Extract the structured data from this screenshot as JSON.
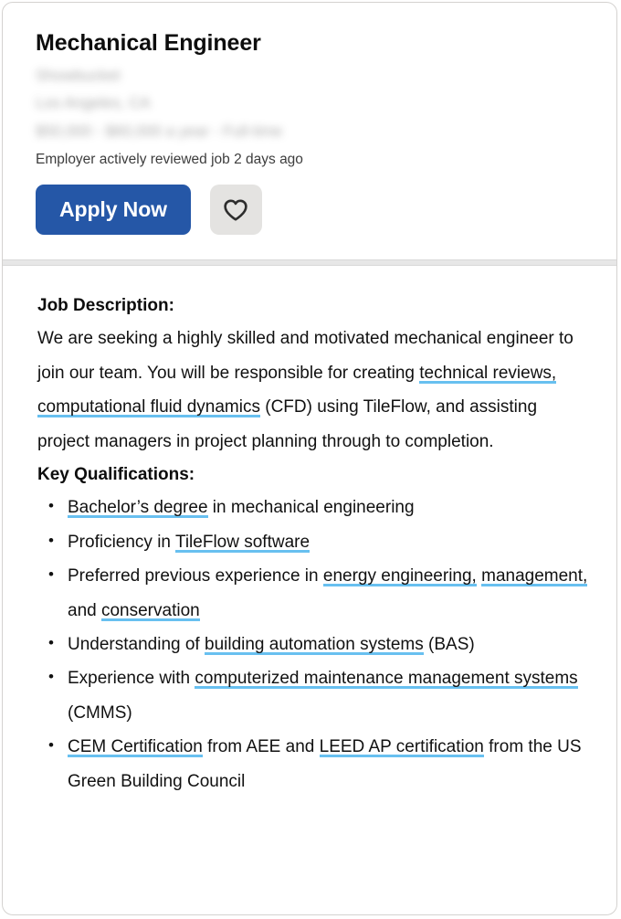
{
  "card": {
    "accent_blue": "#2557a7",
    "highlight_blue": "#68c0f0",
    "save_button_bg": "#e4e3e1"
  },
  "header": {
    "title": "Mechanical Engineer",
    "company": "Showbucket",
    "location": "Los Angeles, CA",
    "salary": "$50,000 - $60,000 a year  -  Full-time",
    "reviewed_note": "Employer actively reviewed job 2 days ago",
    "apply_label": "Apply Now",
    "save_icon": "heart-icon"
  },
  "body": {
    "description_heading": "Job Description:",
    "description": {
      "part1": "We are seeking a highly skilled and motivated mechanical engineer to join our team. You will be responsible for creating ",
      "hl1": "technical reviews,",
      "part2": " ",
      "hl2": "computational fluid dynamics",
      "part3": " (CFD) using TileFlow, and assisting project managers in project planning through to completion."
    },
    "qualifications_heading": "Key Qualifications:",
    "qualifications": [
      {
        "p1": "",
        "h1": "Bachelor’s degree",
        "p2": " in mechanical engineering",
        "h2": "",
        "p3": "",
        "h3": "",
        "p4": ""
      },
      {
        "p1": "Proficiency in ",
        "h1": "TileFlow software",
        "p2": "",
        "h2": "",
        "p3": "",
        "h3": "",
        "p4": ""
      },
      {
        "p1": "Preferred previous experience in ",
        "h1": "energy engineering,",
        "p2": " ",
        "h2": "management,",
        "p3": " and ",
        "h3": "conservation",
        "p4": ""
      },
      {
        "p1": "Understanding of ",
        "h1": "building automation systems",
        "p2": " (BAS)",
        "h2": "",
        "p3": "",
        "h3": "",
        "p4": ""
      },
      {
        "p1": "Experience with ",
        "h1": "computerized maintenance management systems",
        "p2": " (CMMS)",
        "h2": "",
        "p3": "",
        "h3": "",
        "p4": ""
      },
      {
        "p1": "",
        "h1": "CEM Certification",
        "p2": " from AEE and ",
        "h2": "LEED AP certification",
        "p3": " from the US Green Building Council",
        "h3": "",
        "p4": ""
      }
    ]
  }
}
